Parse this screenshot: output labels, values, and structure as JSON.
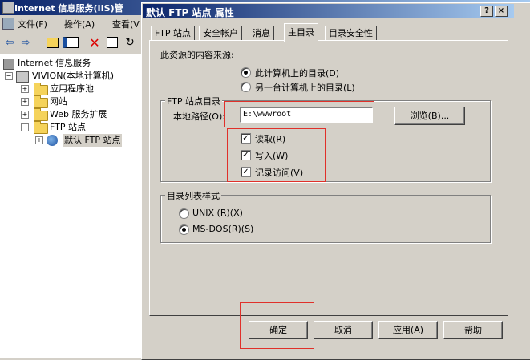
{
  "mmc": {
    "title": "Internet 信息服务(IIS)管",
    "menu": [
      "文件(F)",
      "操作(A)",
      "查看(V"
    ],
    "tree": {
      "root": "Internet 信息服务",
      "computer": "VIVION(本地计算机)",
      "items": [
        "应用程序池",
        "网站",
        "Web 服务扩展",
        "FTP 站点"
      ],
      "site": "默认 FTP 站点"
    }
  },
  "dialog": {
    "title": "默认 FTP 站点 属性",
    "help_btn": "?",
    "close_btn": "×",
    "tabs": [
      "FTP 站点",
      "安全帐户",
      "消息",
      "主目录",
      "目录安全性"
    ],
    "active_tab": "主目录",
    "source_label": "此资源的内容来源:",
    "source_options": [
      "此计算机上的目录(D)",
      "另一台计算机上的目录(L)"
    ],
    "ftp_dir_group": "FTP 站点目录",
    "local_path_label": "本地路径(O):",
    "local_path_value": "E:\\wwwroot",
    "browse_btn": "浏览(B)...",
    "permissions": [
      "读取(R)",
      "写入(W)",
      "记录访问(V)"
    ],
    "listing_group": "目录列表样式",
    "listing_options": [
      "UNIX (R)(X)",
      "MS-DOS(R)(S)"
    ],
    "buttons": {
      "ok": "确定",
      "cancel": "取消",
      "apply": "应用(A)",
      "help": "帮助"
    }
  }
}
